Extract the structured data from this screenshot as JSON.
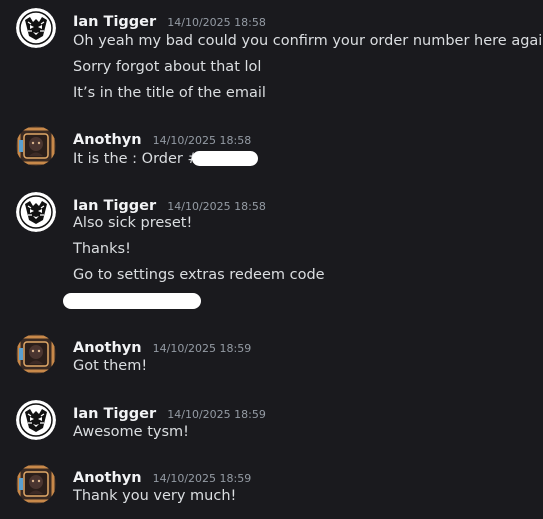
{
  "messages": [
    {
      "author": "Ian Tigger",
      "timestamp": "14/10/2025 18:58",
      "lines": [
        "Oh yeah my bad could you confirm your order number here again",
        "Sorry forgot about that lol",
        "It’s in the title of the email"
      ]
    },
    {
      "author": "Anothyn",
      "timestamp": "14/10/2025 18:58",
      "lines": [
        "It is the : Order #"
      ]
    },
    {
      "author": "Ian Tigger",
      "timestamp": "14/10/2025 18:58",
      "lines": [
        "Also sick preset!",
        "Thanks!",
        "Go to settings extras redeem code"
      ]
    },
    {
      "author": "Anothyn",
      "timestamp": "14/10/2025 18:59",
      "lines": [
        "Got them!"
      ]
    },
    {
      "author": "Ian Tigger",
      "timestamp": "14/10/2025 18:59",
      "lines": [
        "Awesome tysm!"
      ]
    },
    {
      "author": "Anothyn",
      "timestamp": "14/10/2025 18:59",
      "lines": [
        "Thank you very much!"
      ]
    }
  ],
  "avatars": {
    "tiger": "tiger-logo-avatar",
    "anothyn": "framed-portrait-avatar"
  },
  "colors": {
    "background": "#1a1a1e",
    "username": "#f2f3f5",
    "timestamp": "#949ba4",
    "text": "#dbdee1",
    "redaction": "#ffffff"
  }
}
